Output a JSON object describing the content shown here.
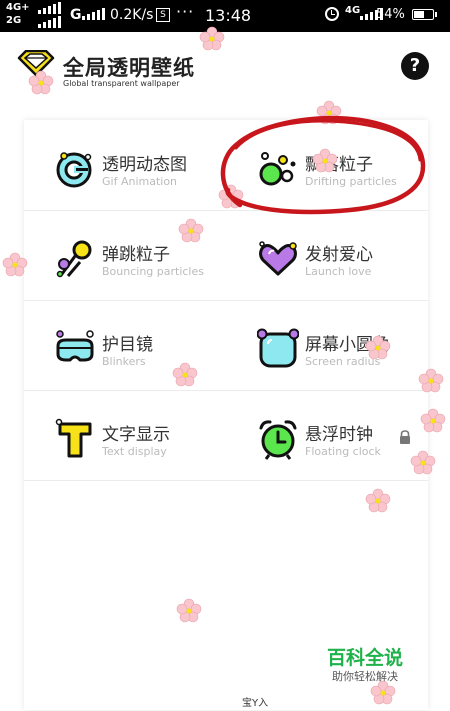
{
  "statusbar": {
    "net1": "4G+",
    "net2": "2G",
    "net3": "G",
    "speed": "0.2K/s",
    "s_icon": "S",
    "dots": "···",
    "time": "13:48",
    "net4": "4G",
    "battery_pct": "54%",
    "battery_level": 0.54
  },
  "header": {
    "title": "全局透明壁纸",
    "subtitle": "Global transparent wallpaper",
    "help": "?"
  },
  "features": [
    {
      "name": "透明动态图",
      "sub": "Gif Animation",
      "icon": "gif-animation-icon"
    },
    {
      "name": "飘落粒子",
      "sub": "Drifting particles",
      "icon": "drifting-particles-icon"
    },
    {
      "name": "弹跳粒子",
      "sub": "Bouncing particles",
      "icon": "bouncing-particles-icon"
    },
    {
      "name": "发射爱心",
      "sub": "Launch love",
      "icon": "launch-love-icon"
    },
    {
      "name": "护目镜",
      "sub": "Blinkers",
      "icon": "goggles-icon"
    },
    {
      "name": "屏幕小圆角",
      "sub": "Screen radius",
      "icon": "screen-radius-icon"
    },
    {
      "name": "文字显示",
      "sub": "Text display",
      "icon": "text-display-icon"
    },
    {
      "name": "悬浮时钟",
      "sub": "Floating clock",
      "icon": "floating-clock-icon"
    }
  ],
  "watermark": {
    "main": "百科全说",
    "sub": "助你轻松解决"
  },
  "bottom_text": "宝Y入",
  "colors": {
    "accent_yellow": "#f7e21a",
    "annotation_red": "#c8161d",
    "watermark_green": "#20b24a",
    "flower_pink": "#f8c6cc"
  }
}
